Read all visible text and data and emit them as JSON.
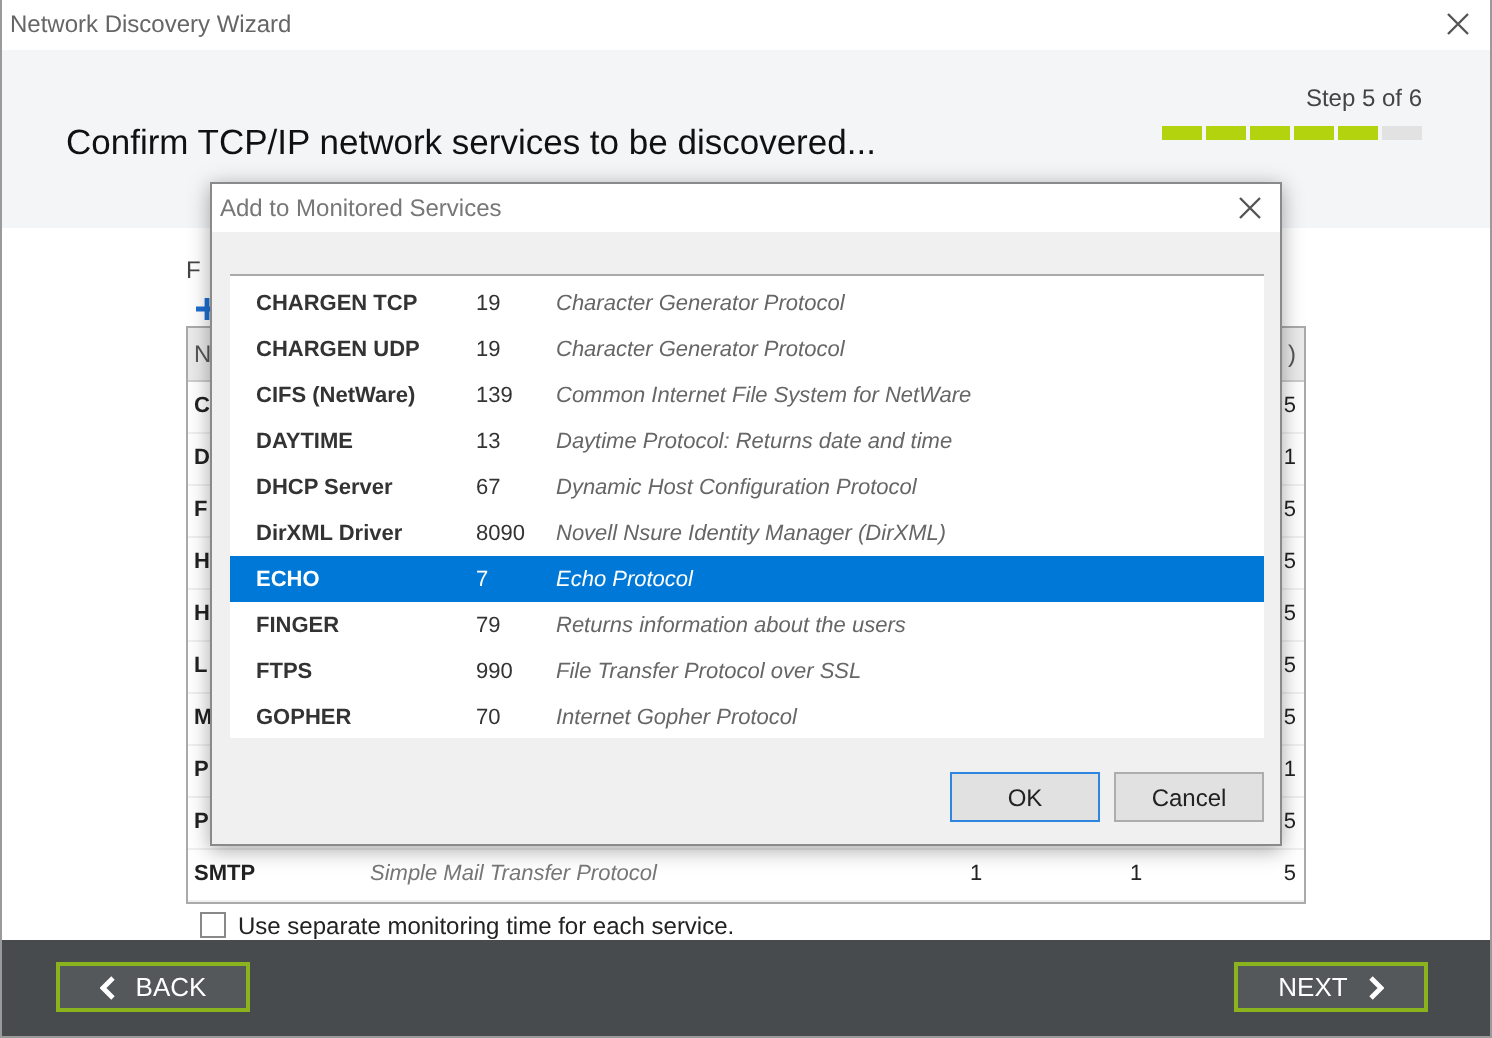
{
  "window": {
    "title": "Network Discovery Wizard"
  },
  "header": {
    "heading": "Confirm TCP/IP network services to be discovered...",
    "step": "Step 5 of 6",
    "progress": [
      {
        "done": true
      },
      {
        "done": true
      },
      {
        "done": true
      },
      {
        "done": true
      },
      {
        "done": true
      },
      {
        "done": false
      }
    ]
  },
  "content": {
    "label": "F",
    "table": {
      "header": {
        "column_1": "N",
        "column_5": ")"
      },
      "rows": [
        {
          "column_1": "C",
          "column_5": "5"
        },
        {
          "column_1": "D",
          "column_5": "1"
        },
        {
          "column_1": "F",
          "column_5": "5"
        },
        {
          "column_1": "H",
          "column_5": "5"
        },
        {
          "column_1": "H",
          "column_5": "5"
        },
        {
          "column_1": "L",
          "column_5": "5"
        },
        {
          "column_1": "M",
          "column_5": "5"
        },
        {
          "column_1": "P",
          "column_5": "1"
        },
        {
          "column_1": "P",
          "column_5": "5"
        },
        {
          "column_1": "SMTP",
          "column_2": "Simple Mail Transfer Protocol",
          "column_3": "1",
          "column_4": "1",
          "column_5": "5"
        }
      ]
    },
    "checkbox": {
      "label": "Use separate monitoring time for each service.",
      "checked": false
    }
  },
  "dialog": {
    "title": "Add to Monitored Services",
    "services": [
      {
        "name": "CHARGEN TCP",
        "port": "19",
        "description": "Character Generator Protocol",
        "selected": false
      },
      {
        "name": "CHARGEN UDP",
        "port": "19",
        "description": "Character Generator Protocol",
        "selected": false
      },
      {
        "name": "CIFS (NetWare)",
        "port": "139",
        "description": "Common Internet File System for NetWare",
        "selected": false
      },
      {
        "name": "DAYTIME",
        "port": "13",
        "description": "Daytime Protocol: Returns date and time",
        "selected": false
      },
      {
        "name": "DHCP Server",
        "port": "67",
        "description": "Dynamic Host Configuration Protocol",
        "selected": false
      },
      {
        "name": "DirXML Driver",
        "port": "8090",
        "description": "Novell Nsure Identity Manager (DirXML)",
        "selected": false
      },
      {
        "name": "ECHO",
        "port": "7",
        "description": "Echo Protocol",
        "selected": true
      },
      {
        "name": "FINGER",
        "port": "79",
        "description": "Returns information about the users",
        "selected": false
      },
      {
        "name": "FTPS",
        "port": "990",
        "description": "File Transfer Protocol over SSL",
        "selected": false
      },
      {
        "name": "GOPHER",
        "port": "70",
        "description": "Internet Gopher Protocol",
        "selected": false
      }
    ],
    "buttons": [
      {
        "label": "OK",
        "default": true
      },
      {
        "label": "Cancel",
        "default": false
      }
    ]
  },
  "footer": {
    "back": "BACK",
    "next": "NEXT"
  }
}
